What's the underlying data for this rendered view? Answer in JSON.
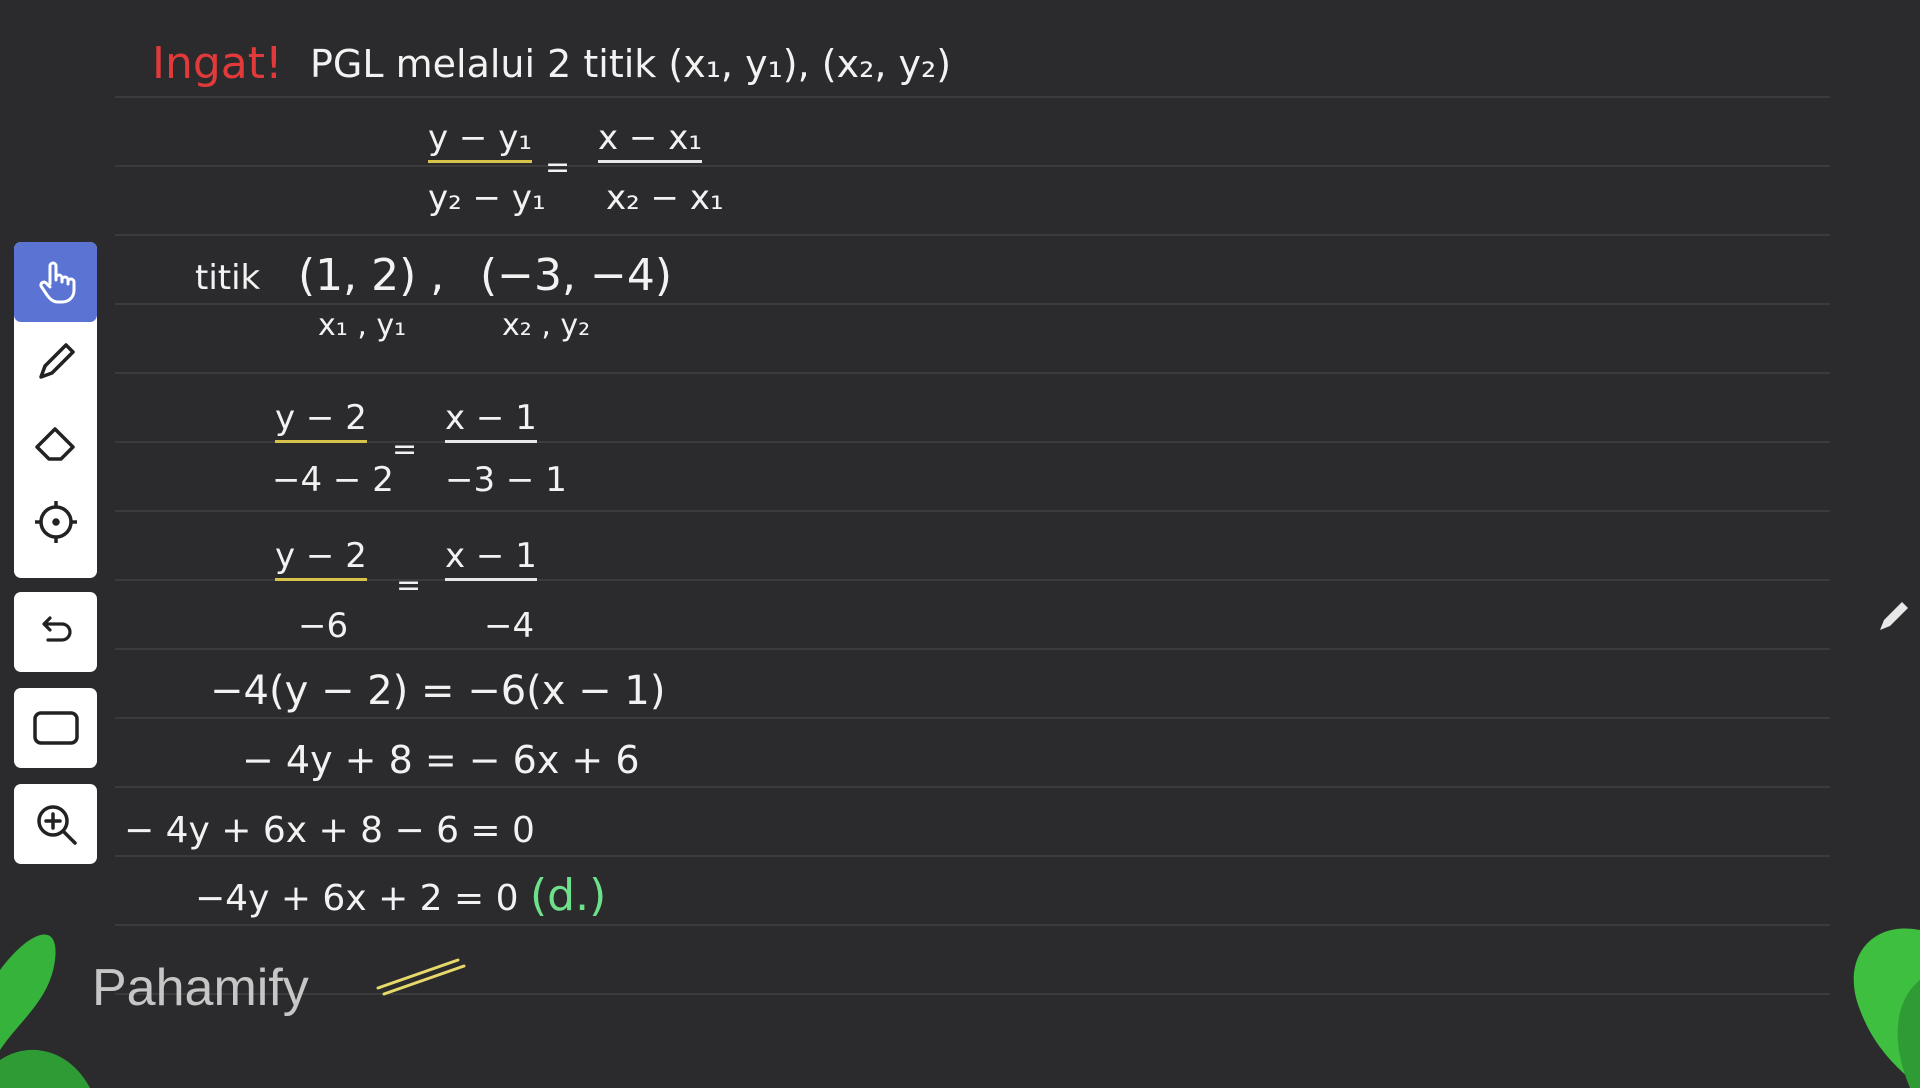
{
  "header": {
    "ingat": "Ingat!",
    "title": "PGL melalui 2 titik (x₁, y₁), (x₂, y₂)"
  },
  "formula": {
    "num_left": "y − y₁",
    "den_left": "y₂ − y₁",
    "eq": "=",
    "num_right": "x − x₁",
    "den_right": "x₂ − x₁"
  },
  "points": {
    "label": "titik",
    "p1": "(1, 2) ,",
    "p2": "(−3, −4)",
    "p1_sub": "x₁ , y₁",
    "p2_sub": "x₂ , y₂"
  },
  "step1": {
    "num_left": "y − 2",
    "den_left": "−4 − 2",
    "eq": "=",
    "num_right": "x − 1",
    "den_right": "−3 − 1"
  },
  "step2": {
    "num_left": "y − 2",
    "den_left": "−6",
    "eq": "=",
    "num_right": "x − 1",
    "den_right": "−4"
  },
  "steps": [
    "−4(y − 2) = −6(x − 1)",
    "− 4y + 8   = − 6x + 6",
    "− 4y + 6x + 8 − 6   = 0",
    "−4y + 6x + 2 = 0"
  ],
  "answer": "(d.)",
  "watermark": "Pahamify",
  "toolbar": {
    "icons": [
      "hand-icon",
      "pen-icon",
      "eraser-icon",
      "laser-pointer-icon",
      "undo-icon",
      "shape-icon",
      "zoom-in-icon"
    ],
    "active": "hand-icon"
  },
  "colors": {
    "background": "#2b2b2d",
    "active_tool": "#5b73d3",
    "heading": "#e23a3a",
    "answer": "#6fe08a",
    "leaf": "#3fbf3f"
  }
}
